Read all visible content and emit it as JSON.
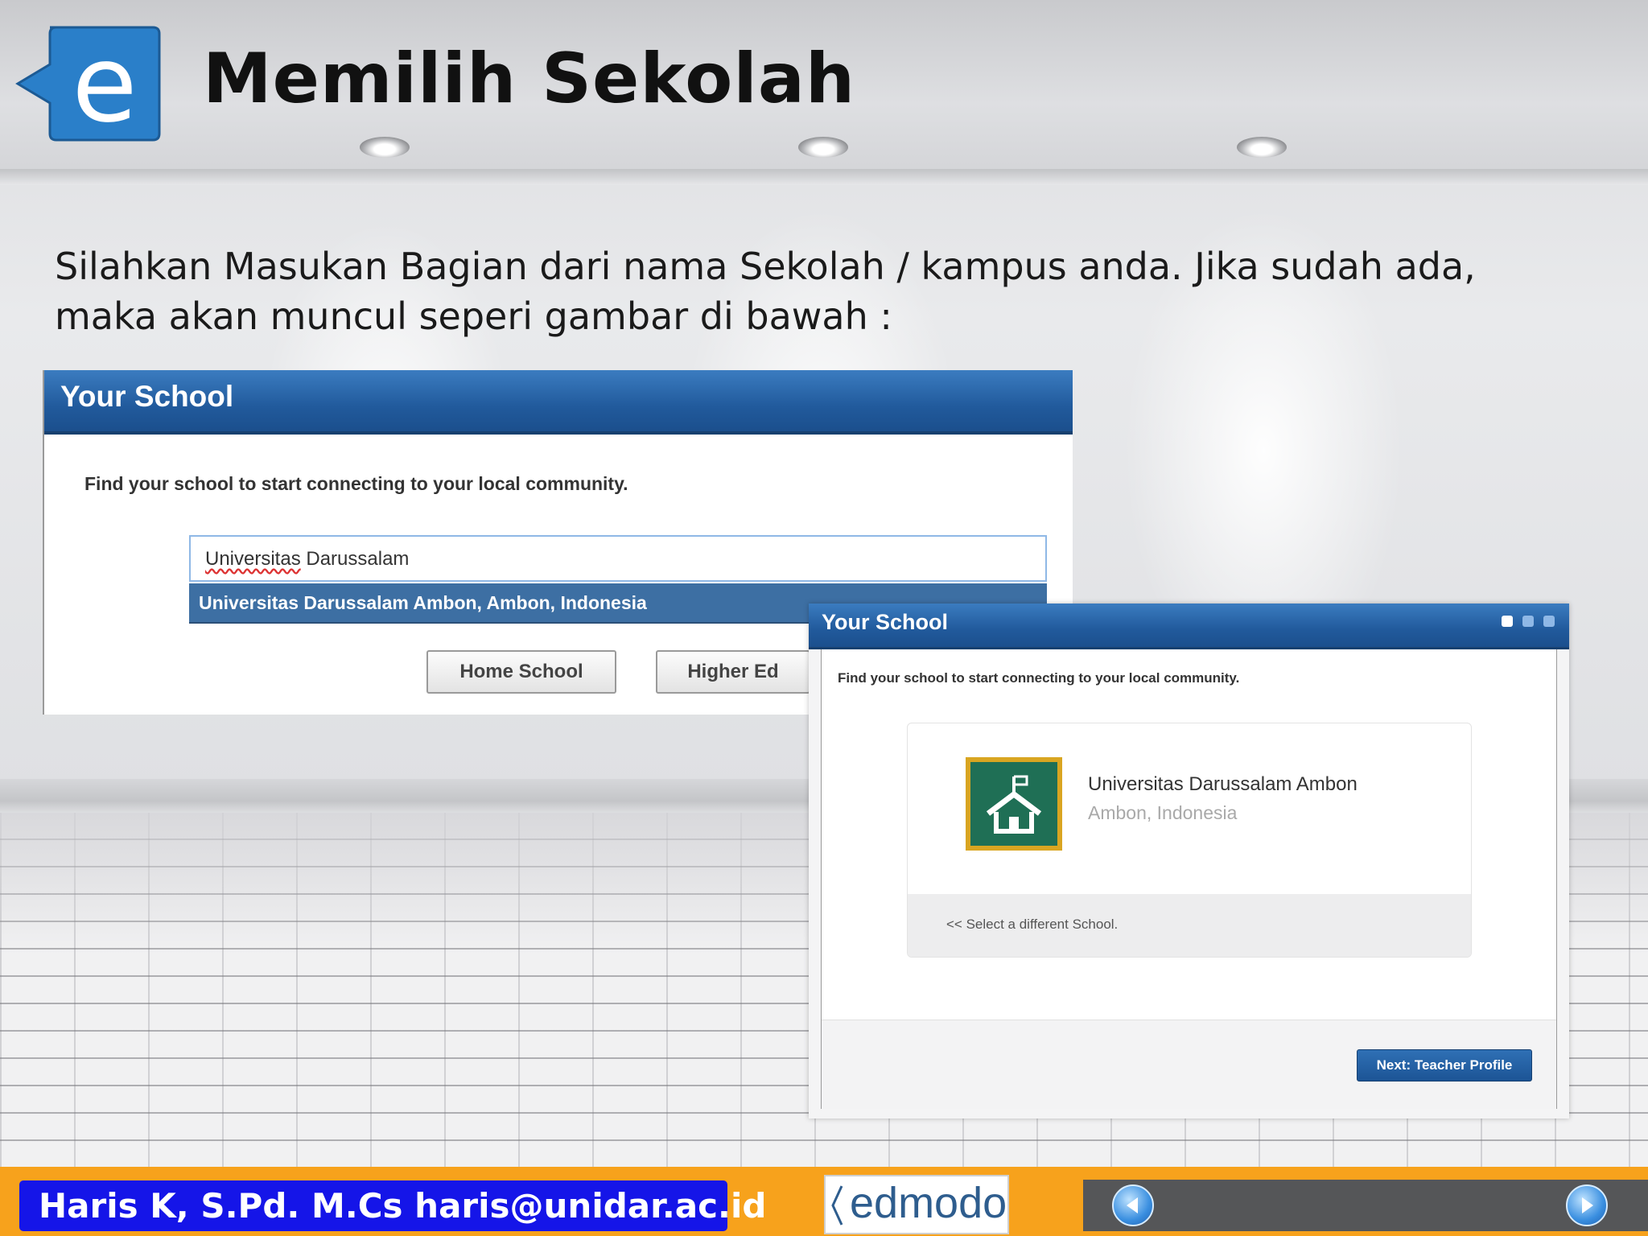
{
  "slide": {
    "title": "Memilih Sekolah",
    "instruction": "Silahkan Masukan Bagian dari nama Sekolah / kampus anda. Jika sudah ada, maka akan muncul seperi gambar di bawah :",
    "logo_letter": "e"
  },
  "screenshot1": {
    "header": "Your School",
    "description": "Find your school to start connecting to your local community.",
    "search_value_part1": "Universitas",
    "search_value_part2": " Darussalam",
    "suggestion": "Universitas Darussalam Ambon, Ambon, Indonesia",
    "buttons": {
      "home_school": "Home School",
      "higher_ed": "Higher Ed"
    }
  },
  "screenshot2": {
    "header": "Your School",
    "description": "Find your school to start connecting to your local community.",
    "school_name": "Universitas Darussalam Ambon",
    "school_location": "Ambon, Indonesia",
    "select_link": "<< Select a different School.",
    "next_button": "Next: Teacher Profile"
  },
  "footer": {
    "author": "Haris K, S.Pd. M.Cs  haris@unidar.ac.id",
    "brand": "edmodo"
  },
  "colors": {
    "header_blue": "#215a9c",
    "footer_orange": "#f7a21c",
    "author_blue": "#1515e8",
    "school_green": "#1f6f55"
  },
  "icons": {
    "logo": "edmodo-e-logo-icon",
    "school": "school-house-icon",
    "prev": "previous-arrow-icon",
    "next": "next-arrow-icon"
  }
}
